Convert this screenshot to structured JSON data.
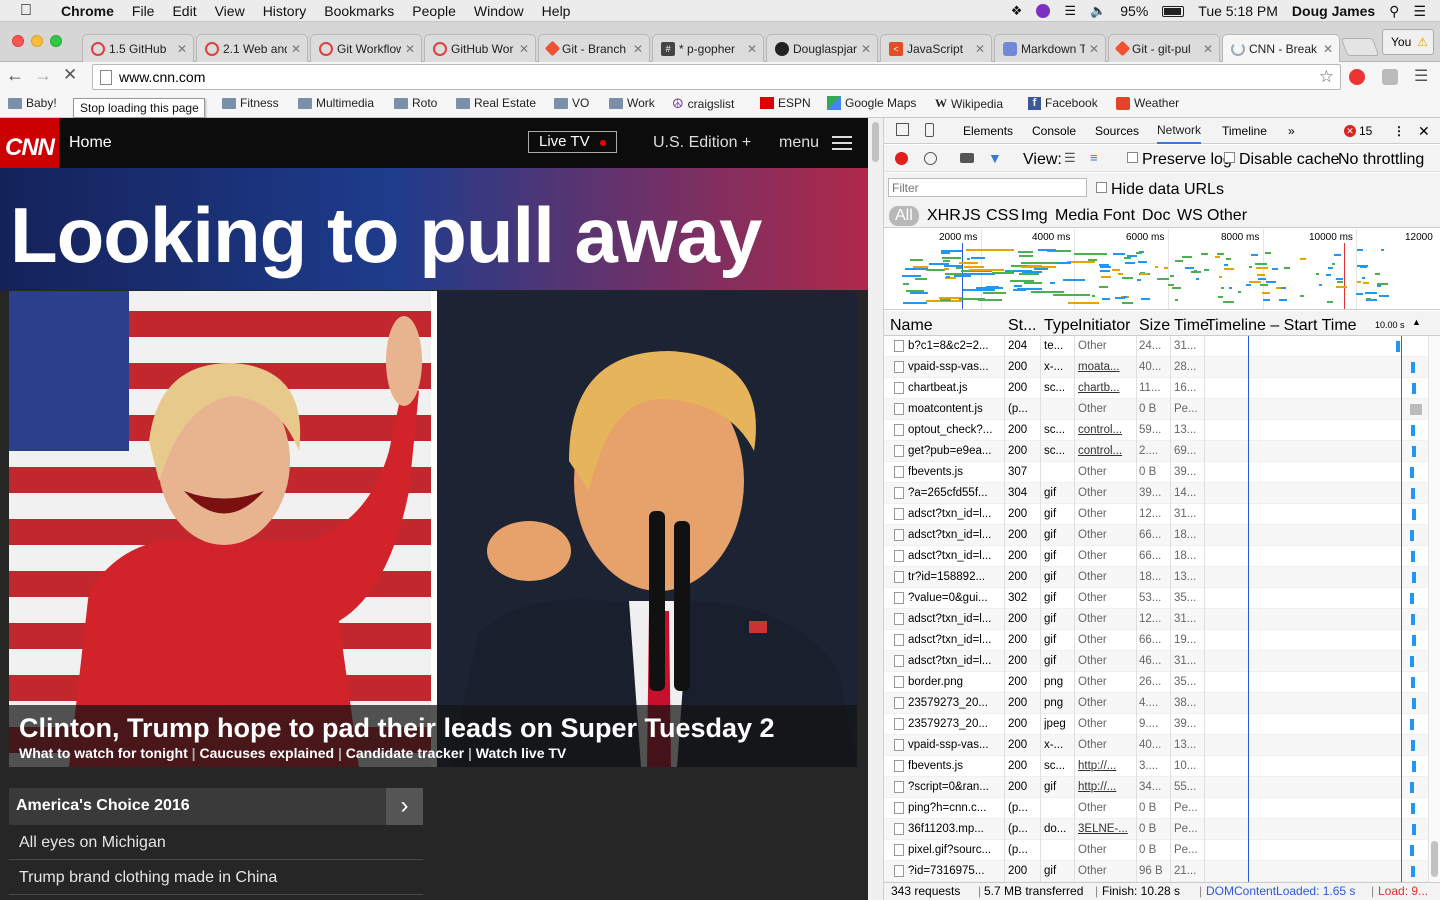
{
  "menubar": {
    "app": "Chrome",
    "items": [
      "File",
      "Edit",
      "View",
      "History",
      "Bookmarks",
      "People",
      "Window",
      "Help"
    ],
    "battery": "95%",
    "clock": "Tue 5:18 PM",
    "user": "Doug James"
  },
  "tabs": [
    {
      "title": "1.5 GitHub",
      "icon": "spinner-icon"
    },
    {
      "title": "2.1 Web and",
      "icon": "spinner-icon"
    },
    {
      "title": "Git Workflow",
      "icon": "spinner-icon"
    },
    {
      "title": "GitHub Wor",
      "icon": "spinner-icon"
    },
    {
      "title": "Git - Branch",
      "icon": "git-icon"
    },
    {
      "title": "* p-gopher",
      "icon": "hash-icon"
    },
    {
      "title": "Douglaspjar",
      "icon": "github-icon"
    },
    {
      "title": "JavaScript",
      "icon": "code-icon"
    },
    {
      "title": "Markdown T",
      "icon": "discord-icon"
    },
    {
      "title": "Git - git-pul",
      "icon": "git-icon"
    },
    {
      "title": "CNN - Break",
      "icon": "loading-icon"
    }
  ],
  "profile_label": "You",
  "address": "www.cnn.com",
  "bookmarks": [
    {
      "label": "Baby!",
      "icon": "folder-icon"
    },
    {
      "label": "Fitness",
      "icon": "folder-icon"
    },
    {
      "label": "Multimedia",
      "icon": "folder-icon"
    },
    {
      "label": "Roto",
      "icon": "folder-icon"
    },
    {
      "label": "Real Estate",
      "icon": "folder-icon"
    },
    {
      "label": "VO",
      "icon": "folder-icon"
    },
    {
      "label": "Work",
      "icon": "folder-icon"
    },
    {
      "label": "craigslist",
      "icon": "peace-icon"
    },
    {
      "label": "ESPN",
      "icon": "espn-icon"
    },
    {
      "label": "Google Maps",
      "icon": "maps-icon"
    },
    {
      "label": "Wikipedia",
      "icon": "wikipedia-icon"
    },
    {
      "label": "Facebook",
      "icon": "facebook-icon"
    },
    {
      "label": "Weather",
      "icon": "weather-icon"
    }
  ],
  "tooltip": "Stop loading this page",
  "cnn": {
    "logo": "CNN",
    "home": "Home",
    "live_tv": "Live TV",
    "edition": "U.S. Edition +",
    "menu": "menu",
    "headline": "Looking to pull away",
    "story_title": "Clinton, Trump hope to pad their leads on Super Tuesday 2",
    "story_links": [
      "What to watch for tonight",
      "Caucuses explained",
      "Candidate tracker",
      "Watch live TV"
    ],
    "section_title": "America's Choice 2016",
    "section_items": [
      "All eyes on Michigan",
      "Trump brand clothing made in China"
    ]
  },
  "devtools": {
    "tabs": [
      "Elements",
      "Console",
      "Sources",
      "Network",
      "Timeline"
    ],
    "active_tab": "Network",
    "error_count": "15",
    "view_label": "View:",
    "preserve_log": "Preserve log",
    "disable_cache": "Disable cache",
    "throttling": "No throttling",
    "filter_placeholder": "Filter",
    "hide_data_urls": "Hide data URLs",
    "filter_types": [
      "All",
      "XHR",
      "JS",
      "CSS",
      "Img",
      "Media",
      "Font",
      "Doc",
      "WS",
      "Other"
    ],
    "overview_ticks": [
      "2000 ms",
      "4000 ms",
      "6000 ms",
      "8000 ms",
      "10000 ms",
      "12000"
    ],
    "columns": [
      "Name",
      "St...",
      "Type",
      "Initiator",
      "Size",
      "Time",
      "Timeline – Start Time"
    ],
    "timeline_end": "10.00 s",
    "rows": [
      {
        "name": "b?c1=8&c2=2...",
        "status": "204",
        "type": "te...",
        "initiator": "Other",
        "size": "24...",
        "time": "31..."
      },
      {
        "name": "vpaid-ssp-vas...",
        "status": "200",
        "type": "x-...",
        "initiator": "moata...",
        "size": "40...",
        "time": "28..."
      },
      {
        "name": "chartbeat.js",
        "status": "200",
        "type": "sc...",
        "initiator": "chartb...",
        "size": "11...",
        "time": "16..."
      },
      {
        "name": "moatcontent.js",
        "status": "(p...",
        "type": "",
        "initiator": "Other",
        "size": "0 B",
        "time": "Pe..."
      },
      {
        "name": "optout_check?...",
        "status": "200",
        "type": "sc...",
        "initiator": "control...",
        "size": "59...",
        "time": "13..."
      },
      {
        "name": "get?pub=e9ea...",
        "status": "200",
        "type": "sc...",
        "initiator": "control...",
        "size": "2....",
        "time": "69..."
      },
      {
        "name": "fbevents.js",
        "status": "307",
        "type": "",
        "initiator": "Other",
        "size": "0 B",
        "time": "39..."
      },
      {
        "name": "?a=265cfd55f...",
        "status": "304",
        "type": "gif",
        "initiator": "Other",
        "size": "39...",
        "time": "14..."
      },
      {
        "name": "adsct?txn_id=l...",
        "status": "200",
        "type": "gif",
        "initiator": "Other",
        "size": "12...",
        "time": "31..."
      },
      {
        "name": "adsct?txn_id=l...",
        "status": "200",
        "type": "gif",
        "initiator": "Other",
        "size": "66...",
        "time": "18..."
      },
      {
        "name": "adsct?txn_id=l...",
        "status": "200",
        "type": "gif",
        "initiator": "Other",
        "size": "66...",
        "time": "18..."
      },
      {
        "name": "tr?id=158892...",
        "status": "200",
        "type": "gif",
        "initiator": "Other",
        "size": "18...",
        "time": "13..."
      },
      {
        "name": "?value=0&gui...",
        "status": "302",
        "type": "gif",
        "initiator": "Other",
        "size": "53...",
        "time": "35..."
      },
      {
        "name": "adsct?txn_id=l...",
        "status": "200",
        "type": "gif",
        "initiator": "Other",
        "size": "12...",
        "time": "31..."
      },
      {
        "name": "adsct?txn_id=l...",
        "status": "200",
        "type": "gif",
        "initiator": "Other",
        "size": "66...",
        "time": "19..."
      },
      {
        "name": "adsct?txn_id=l...",
        "status": "200",
        "type": "gif",
        "initiator": "Other",
        "size": "46...",
        "time": "31..."
      },
      {
        "name": "border.png",
        "status": "200",
        "type": "png",
        "initiator": "Other",
        "size": "26...",
        "time": "35..."
      },
      {
        "name": "23579273_20...",
        "status": "200",
        "type": "png",
        "initiator": "Other",
        "size": "4....",
        "time": "38..."
      },
      {
        "name": "23579273_20...",
        "status": "200",
        "type": "jpeg",
        "initiator": "Other",
        "size": "9....",
        "time": "39..."
      },
      {
        "name": "vpaid-ssp-vas...",
        "status": "200",
        "type": "x-...",
        "initiator": "Other",
        "size": "40...",
        "time": "13..."
      },
      {
        "name": "fbevents.js",
        "status": "200",
        "type": "sc...",
        "initiator": "http://...",
        "size": "3....",
        "time": "10..."
      },
      {
        "name": "?script=0&ran...",
        "status": "200",
        "type": "gif",
        "initiator": "http://...",
        "size": "34...",
        "time": "55..."
      },
      {
        "name": "ping?h=cnn.c...",
        "status": "(p...",
        "type": "",
        "initiator": "Other",
        "size": "0 B",
        "time": "Pe..."
      },
      {
        "name": "36f11203.mp...",
        "status": "(p...",
        "type": "do...",
        "initiator": "3ELNE-...",
        "size": "0 B",
        "time": "Pe..."
      },
      {
        "name": "pixel.gif?sourc...",
        "status": "(p...",
        "type": "",
        "initiator": "Other",
        "size": "0 B",
        "time": "Pe..."
      },
      {
        "name": "?id=7316975...",
        "status": "200",
        "type": "gif",
        "initiator": "Other",
        "size": "96 B",
        "time": "21..."
      }
    ],
    "status": {
      "requests": "343 requests",
      "transferred": "5.7 MB transferred",
      "finish": "Finish: 10.28 s",
      "dcl": "DOMContentLoaded: 1.65 s",
      "load": "Load: 9..."
    }
  },
  "colors": {
    "cnn_red": "#cc0000",
    "devtools_blue": "#3879d9",
    "record_red": "#e0201d",
    "dcl_blue": "#2b5bd9",
    "load_red": "#e03030"
  }
}
